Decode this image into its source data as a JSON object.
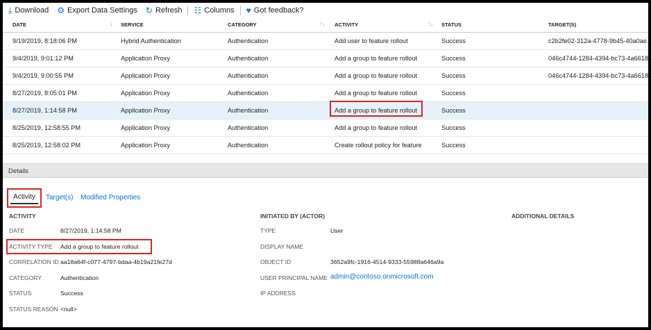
{
  "toolbar": {
    "download": "Download",
    "export": "Export Data Settings",
    "refresh": "Refresh",
    "columns": "Columns",
    "feedback": "Got feedback?"
  },
  "table": {
    "headers": [
      "DATE",
      "SERVICE",
      "CATEGORY",
      "ACTIVITY",
      "STATUS",
      "TARGET(S)"
    ],
    "rows": [
      [
        "9/19/2019, 8:18:06 PM",
        "Hybrid Authentication",
        "Authentication",
        "Add user to feature rollout",
        "Success",
        "c2b2fe02-312a-4778-9b45-40a0ae..."
      ],
      [
        "9/4/2019, 9:01:12 PM",
        "Application Proxy",
        "Authentication",
        "Add a group to feature rollout",
        "Success",
        "046c4744-1284-4394-bc73-4a6618..."
      ],
      [
        "9/4/2019, 9:00:55 PM",
        "Application Proxy",
        "Authentication",
        "Add a group to feature rollout",
        "Success",
        "046c4744-1284-4394-bc73-4a6618..."
      ],
      [
        "8/27/2019, 8:05:01 PM",
        "Application Proxy",
        "Authentication",
        "Add a group to feature rollout",
        "Success",
        ""
      ],
      [
        "8/27/2019, 1:14:58 PM",
        "Application Proxy",
        "Authentication",
        "Add a group to feature rollout",
        "Success",
        ""
      ],
      [
        "8/25/2019, 12:58:55 PM",
        "Application Proxy",
        "Authentication",
        "Add a group to feature rollout",
        "Success",
        ""
      ],
      [
        "8/25/2019, 12:58:02 PM",
        "Application Proxy",
        "Authentication",
        "Create rollout policy for feature",
        "Success",
        ""
      ]
    ],
    "selected_row": 4
  },
  "details": {
    "bar_title": "Details",
    "tabs": [
      "Activity",
      "Target(s)",
      "Modified Properties"
    ],
    "activity": {
      "title": "ACTIVITY",
      "fields": [
        {
          "label": "DATE",
          "value": "8/27/2019, 1:14:58 PM"
        },
        {
          "label": "ACTIVITY TYPE",
          "value": "Add a group to feature rollout"
        },
        {
          "label": "CORRELATION ID",
          "value": "aa18a64f-c077-4797-bdaa-4b19a21fe27d"
        },
        {
          "label": "CATEGORY",
          "value": "Authentication"
        },
        {
          "label": "STATUS",
          "value": "Success"
        },
        {
          "label": "STATUS REASON",
          "value": "<null>"
        }
      ]
    },
    "initiated": {
      "title": "INITIATED BY (ACTOR)",
      "fields": [
        {
          "label": "TYPE",
          "value": "User"
        },
        {
          "label": "DISPLAY NAME",
          "value": ""
        },
        {
          "label": "OBJECT ID",
          "value": "3652a9fc-1916-4514-9333-55988a646a9a"
        },
        {
          "label": "USER PRINCIPAL NAME",
          "value": "admin@contoso.onmicrosoft.com"
        },
        {
          "label": "IP ADDRESS",
          "value": ""
        }
      ]
    },
    "additional_title": "ADDITIONAL DETAILS"
  },
  "colors": {
    "accent": "#0078d4",
    "highlight": "#d9251c",
    "selected_row": "#e6f2fb"
  }
}
